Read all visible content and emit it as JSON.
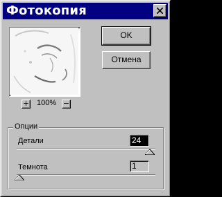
{
  "window": {
    "title": "Фотокопия"
  },
  "preview": {
    "zoom": "100%",
    "zoom_in": "+",
    "zoom_out": "−"
  },
  "buttons": {
    "ok": "OK",
    "cancel": "Отмена"
  },
  "options": {
    "group_label": "Опции",
    "detail": {
      "label": "Детали",
      "value": "24",
      "slider_fraction": 0.96
    },
    "darkness": {
      "label": "Темнота",
      "value": "1",
      "slider_fraction": 0.02
    }
  }
}
